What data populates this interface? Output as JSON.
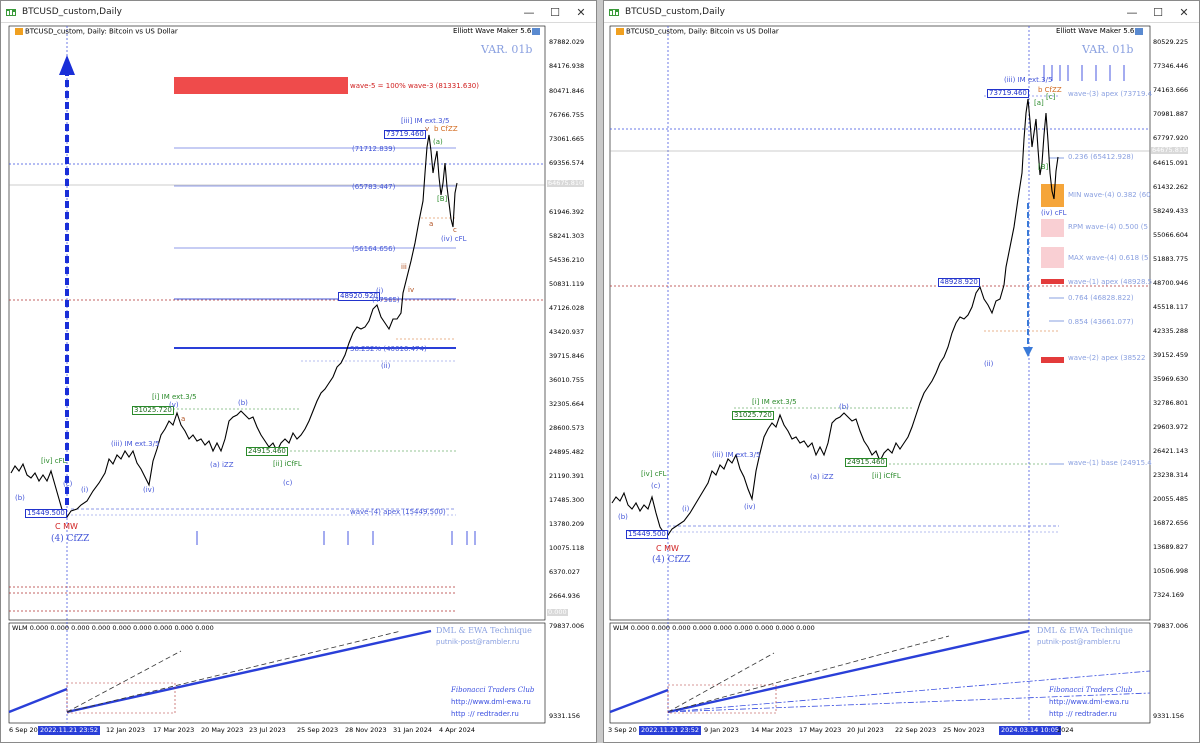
{
  "left_window": {
    "title": "BTCUSD_custom,Daily",
    "chart_header": "BTCUSD_custom, Daily:  Bitcoin vs US Dollar",
    "indicator_name": "Elliott Wave Maker 5.63",
    "variant": "VAR. 01b",
    "price_axis": [
      "87882.029",
      "84176.938",
      "80471.846",
      "76766.755",
      "73061.665",
      "69356.574",
      "65651.483",
      "61946.392",
      "58241.303",
      "54536.210",
      "50831.119",
      "47126.028",
      "43420.937",
      "39715.846",
      "36010.755",
      "32305.664",
      "28600.573",
      "24895.482",
      "21190.391",
      "17485.300",
      "13780.209",
      "10075.118",
      "6370.027",
      "2664.936"
    ],
    "current_price": "64675.810",
    "zero_label": "0.000",
    "sub_axis": [
      "79837.006",
      "9331.156"
    ],
    "time_axis": [
      "6 Sep 20",
      "2022.11.21 23:52",
      "12 Jan 2023",
      "17 Mar 2023",
      "20 May 2023",
      "23 Jul 2023",
      "25 Sep 2023",
      "28 Nov 2023",
      "31 Jan 2024",
      "4 Apr 2024"
    ],
    "wlm": "WLM 0.000 0.000 0.000 0.000 0.000 0.000 0.000 0.000 0.000",
    "credits": {
      "line1": "DML & EWA Technique",
      "line2": "putnik-post@rambler.ru",
      "line3": "Fibonacci    Traders    Club",
      "line4": "http://www.dml-ewa.ru",
      "line5": "http :// redtrader.ru"
    },
    "annotations": {
      "target": "wave-5 = 100% wave-3 (81331.630)",
      "l71712": "(71712.839)",
      "l65783": "(65783.447)",
      "l56164": "(56164.656)",
      "l48920": "48920.920",
      "l47565": "(47565)",
      "l38252": "38.252% (40616.474)",
      "apex": "wave-(4) apex (15449.500)",
      "iii_ext": "[iii] IM ext.3/5",
      "b_cfzz": "b CfZZ",
      "a_bracket": "(a)",
      "b_bracket": "[B]",
      "iv_cfl": "(iv) cFL",
      "box73719": "73719.460",
      "box31025": "31025.720",
      "box24915": "24915.460",
      "box15449": "15449.500",
      "i_ext": "[i] IM ext.3/5",
      "iii_ext2": "(iii) IM ext.3/5",
      "a_izz": "(a) iZZ",
      "ii_icffl": "[ii] iCfFL",
      "iv_cfl_small": "[iv] cFL",
      "cmw": "C MW",
      "four_cfzz": "(4) CfZZ",
      "b_small": "(b)",
      "c_small": "(c)",
      "i_small": "(i)",
      "ii_small": "(ii)",
      "iv_small": "(iv)",
      "iii_small": "iii",
      "iv_small2": "iv",
      "a_small": "a",
      "c_small2": "c",
      "v_small": "v",
      "i_small2": "(i)",
      "v_small2": "(v)"
    }
  },
  "right_window": {
    "title": "BTCUSD_custom,Daily",
    "chart_header": "BTCUSD_custom, Daily:  Bitcoin vs US Dollar",
    "indicator_name": "Elliott Wave Maker 5.63",
    "variant": "VAR. 01b",
    "price_axis": [
      "80529.225",
      "77346.446",
      "74163.666",
      "70981.887",
      "67797.920",
      "64615.091",
      "61432.262",
      "58249.433",
      "55066.604",
      "51883.775",
      "48700.946",
      "45518.117",
      "42335.288",
      "39152.459",
      "35969.630",
      "32786.801",
      "29603.972",
      "26421.143",
      "23238.314",
      "20055.485",
      "16872.656",
      "13689.827",
      "10506.998",
      "7324.169"
    ],
    "current_price": "64675.810",
    "sub_axis": [
      "79837.006",
      "9331.156"
    ],
    "time_axis": [
      "3 Sep 20",
      "2022.11.21 23:52",
      "9 Jan 2023",
      "14 Mar 2023",
      "17 May 2023",
      "20 Jul 2023",
      "22 Sep 2023",
      "25 Nov 2023",
      "2024.03.14 10:05",
      "2024"
    ],
    "wlm": "WLM 0.000 0.000 0.000 0.000 0.000 0.000 0.000 0.000 0.000",
    "credits": {
      "line1": "DML & EWA Technique",
      "line2": "putnik-post@rambler.ru",
      "line3": "Fibonacci    Traders    Club",
      "line4": "http://www.dml-ewa.ru",
      "line5": "http :// redtrader.ru"
    },
    "annotations": {
      "apex3": "wave-(3) apex (73719.4",
      "r0236": "0.236 (65412.928)",
      "min4": "MIN wave-(4) 0.382 (60",
      "rpm4": "RPM wave-(4) 0.500 (5",
      "max4": "MAX wave-(4) 0.618 (5",
      "apex1": "wave-(1) apex (48928.5",
      "r0764": "0.764 (46828.822)",
      "r0854": "0.854 (43661.077)",
      "apex2": "wave-(2) apex (38522",
      "base1": "wave-(1) base (24915.4",
      "box73719": "73719.460",
      "box48928": "48928.920",
      "box31025": "31025.720",
      "box24915": "24915.460",
      "box15449": "15449.500",
      "iii_ext": "(iii) IM ext.3/5",
      "i_ext": "[i] IM ext.3/5",
      "iii_ext2": "(iii) IM ext.3/5",
      "b_cfzz": "b CfZZ",
      "iv_cfl": "(iv) cFL",
      "a_izz": "(a) iZZ",
      "ii_icffl": "[ii] iCfFL",
      "iv_cfl_small": "[iv] cFL",
      "cmw": "C MW",
      "four_cfzz": "(4) CfZZ",
      "b_small": "(b)",
      "c_small": "(c)",
      "i_small": "(i)",
      "ii_small": "(ii)",
      "iv_small": "(iv)",
      "a_bracket": "[a]",
      "b_bracket": "[B]",
      "c_bracket": "[c]"
    }
  },
  "colors": {
    "accent": "#2a3fd8",
    "red": "#ef4b4b",
    "orange": "#f5a53a",
    "pink": "#f9cfd3",
    "green": "#2a8a2a",
    "dashblue": "#3a4fe0"
  }
}
